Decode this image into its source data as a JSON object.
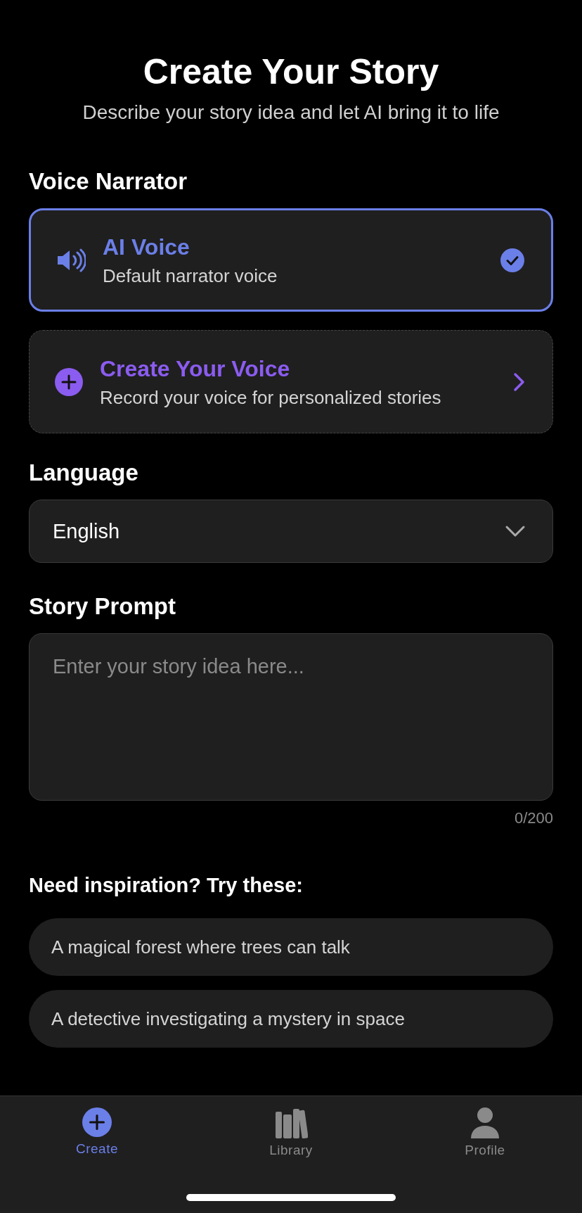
{
  "header": {
    "title": "Create Your Story",
    "subtitle": "Describe your story idea and let AI bring it to life"
  },
  "voice_narrator": {
    "label": "Voice Narrator",
    "options": [
      {
        "kind": "preset",
        "title": "AI Voice",
        "subtitle": "Default narrator voice",
        "selected": true
      },
      {
        "kind": "create",
        "title": "Create Your Voice",
        "subtitle": "Record your voice for personalized stories",
        "selected": false
      }
    ]
  },
  "language": {
    "label": "Language",
    "value": "English"
  },
  "story_prompt": {
    "label": "Story Prompt",
    "placeholder": "Enter your story idea here...",
    "counter": "0/200"
  },
  "inspiration": {
    "label": "Need inspiration? Try these:",
    "suggestions": [
      "A magical forest where trees can talk",
      "A detective investigating a mystery in space"
    ]
  },
  "tab_bar": {
    "tabs": [
      {
        "kind": "create",
        "label": "Create",
        "selected": true
      },
      {
        "kind": "library",
        "label": "Library",
        "selected": false
      },
      {
        "kind": "profile",
        "label": "Profile",
        "selected": false
      }
    ]
  }
}
